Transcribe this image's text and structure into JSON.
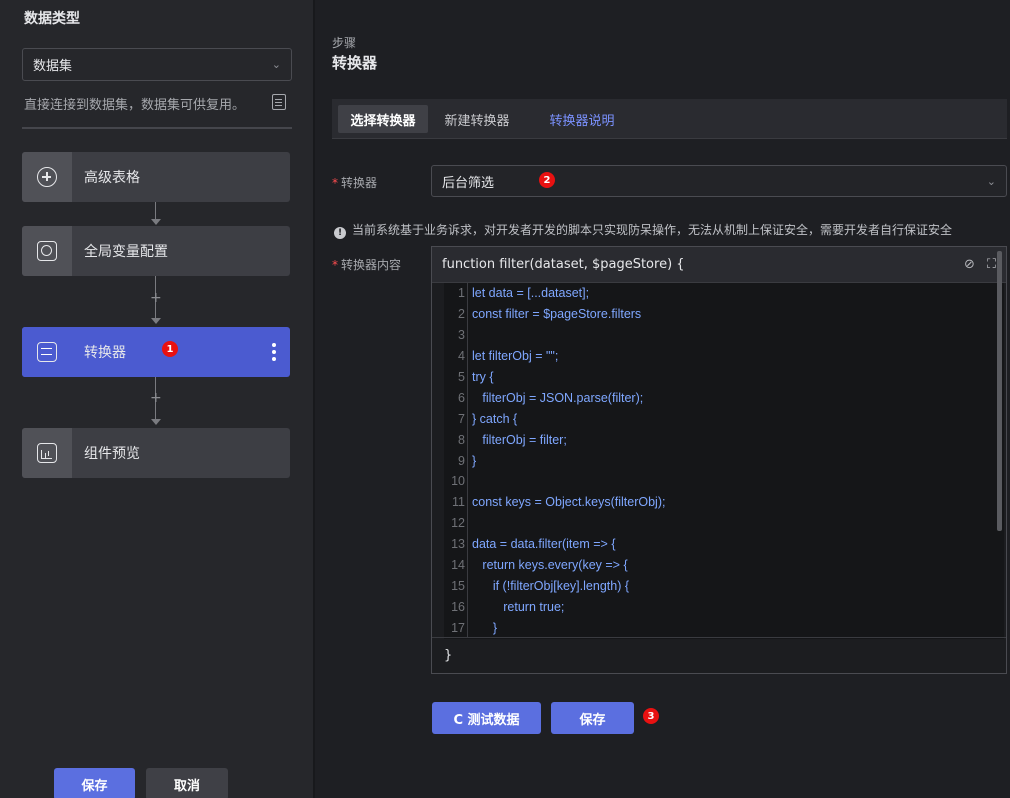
{
  "left": {
    "title": "数据类型",
    "select_value": "数据集",
    "description": "直接连接到数据集，数据集可供复用。",
    "nodes": [
      {
        "label": "高级表格",
        "icon": "circle-plus-icon"
      },
      {
        "label": "全局变量配置",
        "icon": "global-variable-icon"
      },
      {
        "label": "转换器",
        "icon": "converter-icon",
        "badge": "1"
      },
      {
        "label": "组件预览",
        "icon": "chart-preview-icon"
      }
    ],
    "save_label": "保存",
    "cancel_label": "取消"
  },
  "step": {
    "label": "步骤",
    "title": "转换器"
  },
  "tabs": [
    {
      "label": "选择转换器",
      "active": true
    },
    {
      "label": "新建转换器",
      "active": false
    },
    {
      "label": "转换器说明",
      "active": false
    }
  ],
  "form": {
    "converter_label": "转换器",
    "converter_value": "后台筛选",
    "converter_badge": "2",
    "warning": "当前系统基于业务诉求，对开发者开发的脚本只实现防呆操作，无法从机制上保证安全，需要开发者自行保证安全",
    "content_label": "转换器内容",
    "required_mark": "*"
  },
  "editor": {
    "signature": "function filter(dataset, $pageStore) {",
    "closing": "}",
    "lines": [
      "let data = [...dataset];",
      "const filter = $pageStore.filters",
      "",
      "let filterObj = \"\";",
      "try {",
      "   filterObj = JSON.parse(filter);",
      "} catch {",
      "   filterObj = filter;",
      "}",
      "",
      "const keys = Object.keys(filterObj);",
      "",
      "data = data.filter(item => {",
      "   return keys.every(key => {",
      "      if (!filterObj[key].length) {",
      "         return true;",
      "      }"
    ],
    "line_numbers": [
      "1",
      "2",
      "3",
      "4",
      "5",
      "6",
      "7",
      "8",
      "9",
      "10",
      "11",
      "12",
      "13",
      "14",
      "15",
      "16",
      "17"
    ]
  },
  "actions": {
    "test_icon": "refresh-icon",
    "test_label": "C 测试数据",
    "save_label": "保存",
    "save_badge": "3"
  },
  "colors": {
    "accent": "#5b6fe0",
    "active_node": "#4b5bd0",
    "badge": "#e81111",
    "link": "#7b92ff"
  }
}
